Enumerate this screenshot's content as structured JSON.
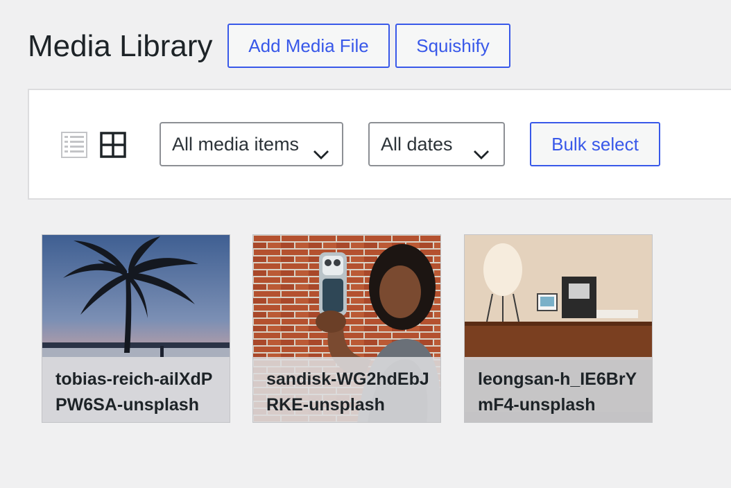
{
  "header": {
    "title": "Media Library",
    "add_media_label": "Add Media File",
    "squishify_label": "Squishify"
  },
  "toolbar": {
    "list_view_icon": "list-view-icon",
    "grid_view_icon": "grid-view-icon",
    "media_filter": {
      "selected": "All media items"
    },
    "date_filter": {
      "selected": "All dates"
    },
    "bulk_select_label": "Bulk select"
  },
  "media_items": [
    {
      "filename": "tobias-reich-ailXdPPW6SA-unsplash"
    },
    {
      "filename": "sandisk-WG2hdEbJRKE-unsplash"
    },
    {
      "filename": "leongsan-h_IE6BrYmF4-unsplash"
    }
  ],
  "colors": {
    "accent": "#3858e9",
    "background": "#f0f0f1"
  }
}
